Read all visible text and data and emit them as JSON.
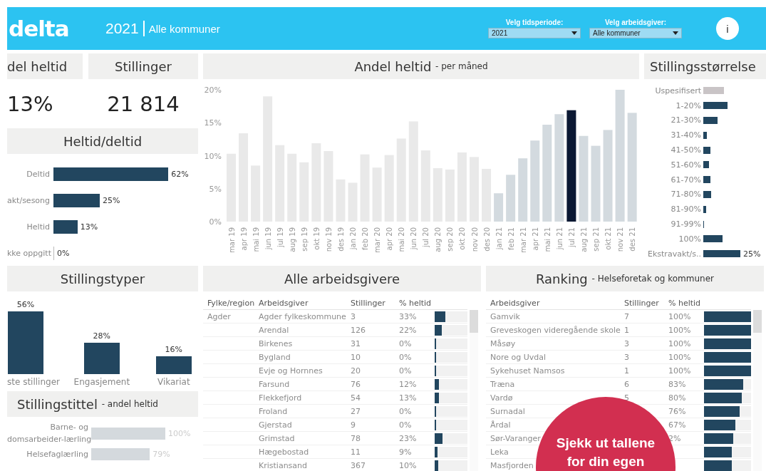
{
  "header": {
    "logo": "delta",
    "year": "2021",
    "scope": "Alle kommuner",
    "filters": [
      {
        "label": "Velg tidsperiode:",
        "value": "2021"
      },
      {
        "label": "Velg arbeidsgiver:",
        "value": "Alle kommuner"
      }
    ],
    "info_button": "i"
  },
  "kpis": [
    {
      "title": "del heltid",
      "value": "13%"
    },
    {
      "title": "Stillinger",
      "value": "21 814"
    }
  ],
  "heltid_deltid": {
    "title": "Heltid/deltid",
    "bars": [
      {
        "label": "Deltid",
        "value": "62%"
      },
      {
        "label": "akt/sesong",
        "value": "25%"
      },
      {
        "label": "Heltid",
        "value": "13%"
      },
      {
        "label": "kke oppgitt",
        "value": "0%"
      }
    ]
  },
  "monthly": {
    "title": "Andel heltid",
    "subtitle": "- per måned",
    "chart_data": {
      "type": "bar",
      "categories": [
        "mar 19",
        "apr 19",
        "mai 19",
        "jun 19",
        "jul 19",
        "aug 19",
        "sep 19",
        "okt 19",
        "nov 19",
        "des 19",
        "jan 20",
        "feb 20",
        "mar 20",
        "apr 20",
        "mai 20",
        "jun 20",
        "jul 20",
        "aug 20",
        "sep 20",
        "okt 20",
        "nov 20",
        "des 20",
        "jan 21",
        "feb 21",
        "mar 21",
        "apr 21",
        "mai 21",
        "jun 21",
        "jul 21",
        "aug 21",
        "sep 21",
        "okt 21",
        "nov 21",
        "des 21"
      ],
      "yticks": [
        {
          "value": 0,
          "label": "0%"
        },
        {
          "value": 5,
          "label": "5%"
        },
        {
          "value": 10,
          "label": "10%"
        },
        {
          "value": 15,
          "label": "15%"
        },
        {
          "value": 20,
          "label": "20%"
        }
      ],
      "ylim": [
        0,
        20
      ],
      "series": [
        {
          "color": "#e9e9e9",
          "values": [
            10.3,
            13.4,
            8.5,
            19,
            11.6,
            10.3,
            9,
            11.9,
            10.7,
            6.4,
            5.9,
            10.2,
            8.2,
            10.1,
            12.6,
            15.2,
            10.8,
            8.1,
            7.9,
            10.5,
            9.8,
            8,
            null,
            null,
            null,
            null,
            null,
            null,
            null,
            null,
            null,
            null,
            null,
            null
          ]
        },
        {
          "color": "#d3dadf",
          "values": [
            null,
            null,
            null,
            null,
            null,
            null,
            null,
            null,
            null,
            null,
            null,
            null,
            null,
            null,
            null,
            null,
            null,
            null,
            null,
            null,
            null,
            null,
            4.3,
            7.1,
            9.6,
            12.3,
            14.7,
            16.3,
            null,
            13,
            11.5,
            13.9,
            20,
            16.5
          ]
        },
        {
          "color": "#0b1833",
          "values": [
            null,
            null,
            null,
            null,
            null,
            null,
            null,
            null,
            null,
            null,
            null,
            null,
            null,
            null,
            null,
            null,
            null,
            null,
            null,
            null,
            null,
            null,
            null,
            null,
            null,
            null,
            null,
            null,
            16.9,
            null,
            null,
            null,
            null,
            null
          ]
        }
      ]
    }
  },
  "stillingsstorrelse": {
    "title": "Stillingsstørrelse",
    "bars": [
      {
        "label": "Uspesifisert",
        "color": "#c9c4c6"
      },
      {
        "label": "1-20%",
        "color": "#22465f"
      },
      {
        "label": "21-30%",
        "color": "#22465f"
      },
      {
        "label": "31-40%",
        "color": "#22465f"
      },
      {
        "label": "41-50%",
        "color": "#22465f"
      },
      {
        "label": "51-60%",
        "color": "#22465f"
      },
      {
        "label": "61-70%",
        "color": "#22465f"
      },
      {
        "label": "71-80%",
        "color": "#22465f"
      },
      {
        "label": "81-90%",
        "color": "#22465f"
      },
      {
        "label": "91-99%",
        "color": "#22465f"
      },
      {
        "label": "100%",
        "color": "#22465f"
      },
      {
        "label": "Ekstravakt/s..",
        "color": "#22465f",
        "value": "25%"
      }
    ]
  },
  "stillingstyper": {
    "title": "Stillingstyper",
    "bars": [
      {
        "label": "ste stillinger",
        "value": "56%"
      },
      {
        "label": "Engasjement",
        "value": "28%"
      },
      {
        "label": "Vikariat",
        "value": "16%"
      }
    ]
  },
  "stillingstittel": {
    "title": "Stillingstittel",
    "subtitle": "- andel heltid",
    "bars": [
      {
        "label_lines": [
          "Barne- og",
          "domsarbeider-lærling"
        ],
        "value": "100%"
      },
      {
        "label_lines": [
          "Helsefaglærling"
        ],
        "value": "79%"
      }
    ]
  },
  "alle_arbeidsgivere": {
    "title": "Alle arbeidsgivere",
    "columns": [
      "Fylke/region",
      "Arbeidsgiver",
      "Stillinger",
      "% heltid"
    ],
    "rows": [
      {
        "region": "Agder",
        "employer": "Agder fylkeskommune",
        "count": "3",
        "pct": "33%",
        "level": 0.33
      },
      {
        "employer": "Arendal",
        "count": "126",
        "pct": "22%",
        "level": 0.22
      },
      {
        "employer": "Birkenes",
        "count": "31",
        "pct": "0%",
        "level": 0
      },
      {
        "employer": "Bygland",
        "count": "10",
        "pct": "0%",
        "level": 0
      },
      {
        "employer": "Evje og Hornnes",
        "count": "20",
        "pct": "0%",
        "level": 0
      },
      {
        "employer": "Farsund",
        "count": "76",
        "pct": "12%",
        "level": 0.12
      },
      {
        "employer": "Flekkefjord",
        "count": "54",
        "pct": "13%",
        "level": 0.13
      },
      {
        "employer": "Froland",
        "count": "27",
        "pct": "0%",
        "level": 0
      },
      {
        "employer": "Gjerstad",
        "count": "9",
        "pct": "0%",
        "level": 0
      },
      {
        "employer": "Grimstad",
        "count": "78",
        "pct": "23%",
        "level": 0.23
      },
      {
        "employer": "Hægebostad",
        "count": "11",
        "pct": "9%",
        "level": 0.09
      },
      {
        "employer": "Kristiansand",
        "count": "367",
        "pct": "10%",
        "level": 0.1
      }
    ]
  },
  "ranking": {
    "title": "Ranking",
    "subtitle": "- Helseforetak og kommuner",
    "columns": [
      "Arbeidsgiver",
      "Stillinger",
      "% heltid"
    ],
    "rows": [
      {
        "employer": "Gamvik",
        "count": "7",
        "pct": "100%",
        "level": 1
      },
      {
        "employer": "Greveskogen videregående skole",
        "count": "1",
        "pct": "100%",
        "level": 1
      },
      {
        "employer": "Måsøy",
        "count": "3",
        "pct": "100%",
        "level": 1
      },
      {
        "employer": "Nore og Uvdal",
        "count": "3",
        "pct": "100%",
        "level": 1
      },
      {
        "employer": "Sykehuset Namsos",
        "count": "1",
        "pct": "100%",
        "level": 1
      },
      {
        "employer": "Træna",
        "count": "6",
        "pct": "83%",
        "level": 0.83
      },
      {
        "employer": "Vardø",
        "count": "5",
        "pct": "80%",
        "level": 0.8
      },
      {
        "employer": "Surnadal",
        "pct": "76%",
        "level": 0.76
      },
      {
        "employer": "Årdal",
        "pct": "67%",
        "level": 0.67
      },
      {
        "employer": "Sør-Varanger",
        "pct": "2%",
        "level": 0.62
      },
      {
        "employer": "Leka",
        "level": 0.59
      },
      {
        "employer": "Masfjorden",
        "level": 0.59
      }
    ]
  },
  "promo": {
    "lines": [
      "Sjekk ut tallene",
      "for din egen"
    ]
  }
}
